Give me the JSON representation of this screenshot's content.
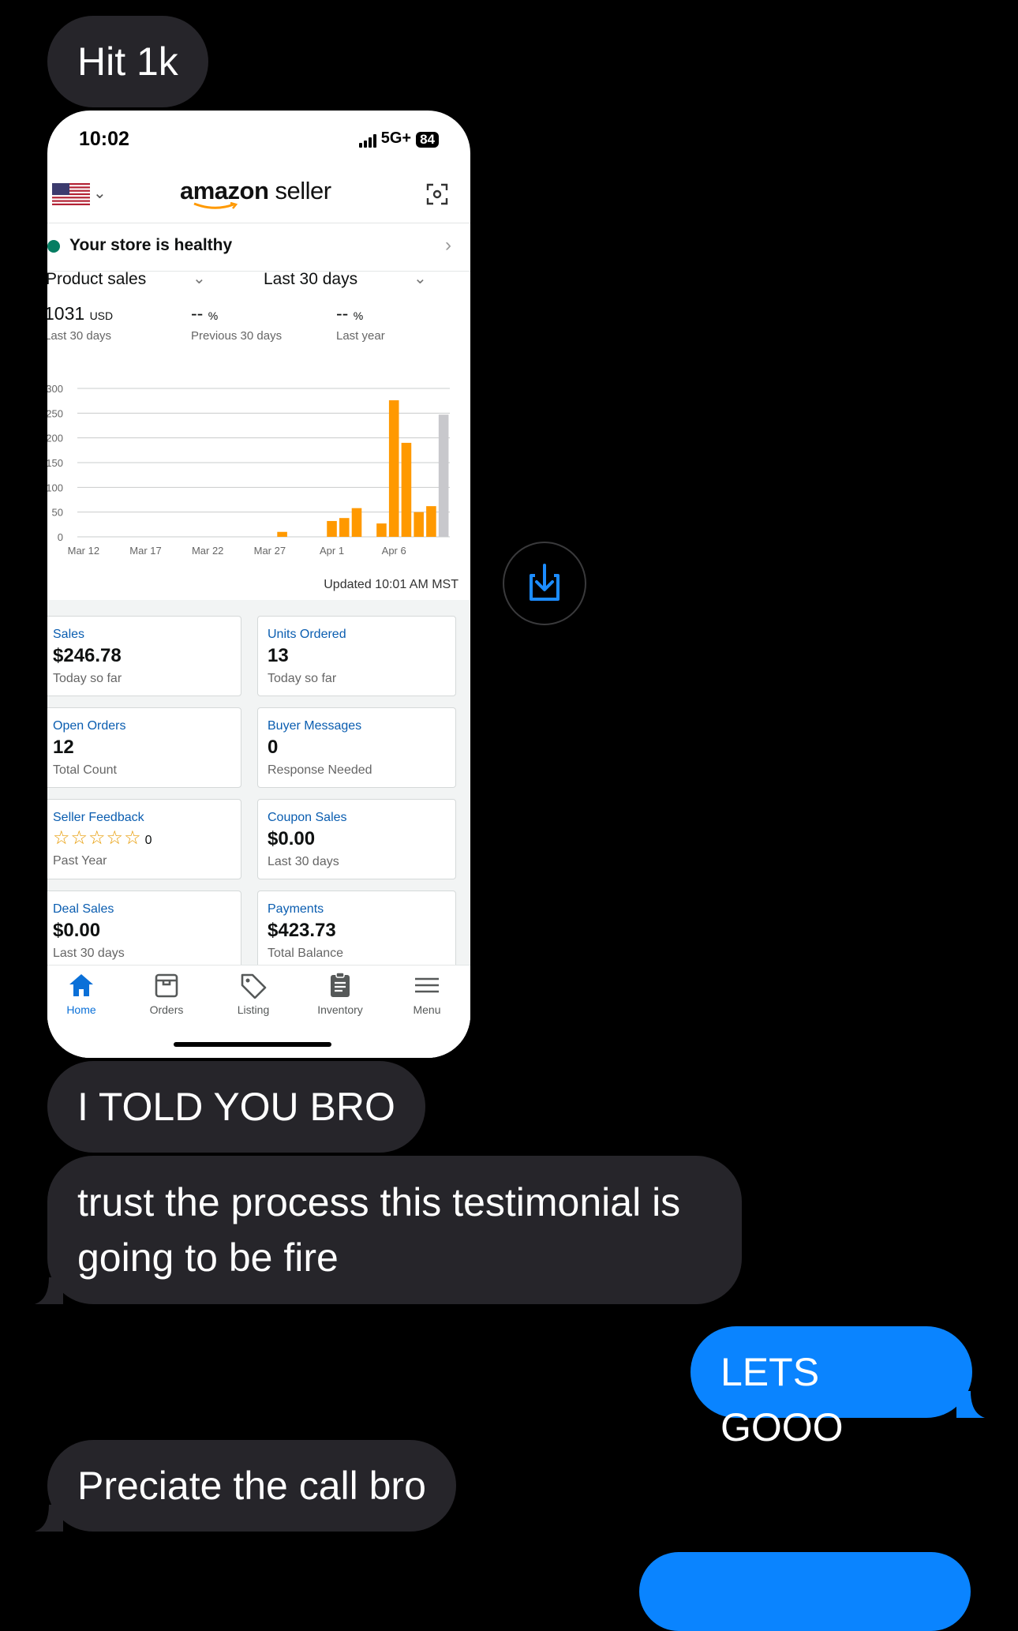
{
  "messages": {
    "m1": "Hit 1k",
    "m2": "I TOLD YOU BRO",
    "m3": "trust the process this testimonial is going to be fire",
    "m4": "LETS GOOO",
    "m5": "Preciate the call bro"
  },
  "status_bar": {
    "time": "10:02",
    "network": "5G+",
    "battery": "84"
  },
  "app": {
    "logo_main": "amazon",
    "logo_sub": "seller",
    "health": "Your store is healthy",
    "filter_metric": "Product sales",
    "filter_range": "Last 30 days",
    "metrics": [
      {
        "value": "1031",
        "unit": "USD",
        "label": "Last 30 days"
      },
      {
        "value": "--",
        "unit": "%",
        "label": "Previous 30 days"
      },
      {
        "value": "--",
        "unit": "%",
        "label": "Last year"
      }
    ],
    "updated": "Updated 10:01 AM MST",
    "cards": [
      {
        "title": "Sales",
        "value": "$246.78",
        "sub": "Today so far"
      },
      {
        "title": "Units Ordered",
        "value": "13",
        "sub": "Today so far"
      },
      {
        "title": "Open Orders",
        "value": "12",
        "sub": "Total Count"
      },
      {
        "title": "Buyer Messages",
        "value": "0",
        "sub": "Response Needed"
      },
      {
        "title": "Seller Feedback",
        "value": "☆☆☆☆☆",
        "count": "0",
        "sub": "Past Year",
        "rating": 0
      },
      {
        "title": "Coupon Sales",
        "value": "$0.00",
        "sub": "Last 30 days"
      },
      {
        "title": "Deal Sales",
        "value": "$0.00",
        "sub": "Last 30 days"
      },
      {
        "title": "Payments",
        "value": "$423.73",
        "sub": "Total Balance"
      }
    ],
    "tabs": [
      "Home",
      "Orders",
      "Listing",
      "Inventory",
      "Menu"
    ],
    "colors": {
      "accent": "#0a70d8",
      "bar": "#ff9900",
      "bar_partial": "#c8c8cc",
      "sent_bubble": "#0a84ff",
      "recv_bubble": "#26252a"
    }
  },
  "chart_data": {
    "type": "bar",
    "ylim": [
      0,
      300
    ],
    "yticks": [
      "0",
      "50",
      "100",
      "150",
      "200",
      "250",
      "300"
    ],
    "xticks": [
      "Mar 12",
      "Mar 17",
      "Mar 22",
      "Mar 27",
      "Apr 1",
      "Apr 6"
    ],
    "categories": [
      "Mar 12",
      "Mar 13",
      "Mar 14",
      "Mar 15",
      "Mar 16",
      "Mar 17",
      "Mar 18",
      "Mar 19",
      "Mar 20",
      "Mar 21",
      "Mar 22",
      "Mar 23",
      "Mar 24",
      "Mar 25",
      "Mar 26",
      "Mar 27",
      "Mar 28",
      "Mar 29",
      "Mar 30",
      "Mar 31",
      "Apr 1",
      "Apr 2",
      "Apr 3",
      "Apr 4",
      "Apr 5",
      "Apr 6",
      "Apr 7",
      "Apr 8",
      "Apr 9",
      "Apr 10"
    ],
    "values": [
      0,
      0,
      0,
      0,
      0,
      0,
      0,
      0,
      0,
      0,
      0,
      0,
      0,
      0,
      0,
      0,
      10,
      0,
      0,
      0,
      32,
      38,
      58,
      0,
      27,
      276,
      190,
      50,
      62,
      50
    ],
    "partial_values": [
      0,
      0,
      0,
      0,
      0,
      0,
      0,
      0,
      0,
      0,
      0,
      0,
      0,
      0,
      0,
      0,
      0,
      0,
      0,
      0,
      0,
      0,
      0,
      0,
      0,
      0,
      0,
      0,
      0,
      247
    ]
  }
}
